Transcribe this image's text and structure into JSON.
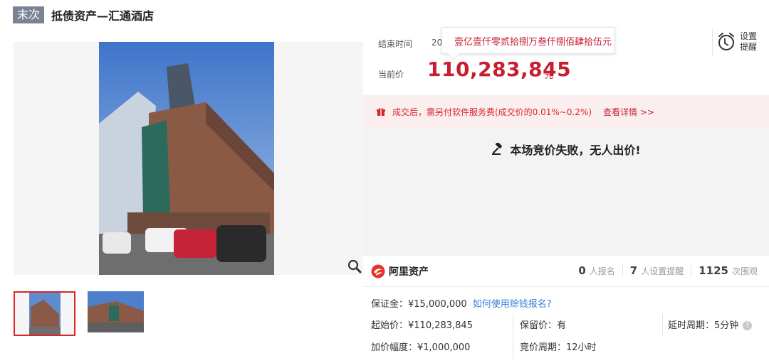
{
  "header": {
    "badge": "末次",
    "title": "抵债资产—汇通酒店"
  },
  "auction": {
    "end_label": "结束时间",
    "end_value": "20",
    "price_label": "当前价",
    "price_value": "110,283,845",
    "price_unit": "元",
    "price_tooltip": "壹亿壹仟零贰拾捌万叁仟捌佰肆拾伍元"
  },
  "remind": {
    "label_line1": "设置",
    "label_line2": "提醒",
    "icon": "alarm-clock-icon"
  },
  "fee_notice": {
    "text": "成交后，需另付软件服务费(成交价的0.01%~0.2%)",
    "link": "查看详情 >>",
    "icon": "gift-icon"
  },
  "result": {
    "text": "本场竞价失败，无人出价!",
    "icon": "gavel-icon"
  },
  "platform": {
    "name": "阿里资产"
  },
  "stats": [
    {
      "num": "0",
      "label": "人报名"
    },
    {
      "num": "7",
      "label": "人设置提醒"
    },
    {
      "num": "1125",
      "label": "次围观"
    }
  ],
  "details": {
    "deposit": "保证金：¥15,000,000",
    "deposit_link": "如何使用赊钱报名?",
    "start_price": "起始价：¥110,283,845",
    "reserve": "保留价：有",
    "delay": "延时周期：5分钟",
    "increment": "加价幅度：¥1,000,000",
    "cycle": "竞价周期：12小时"
  },
  "colors": {
    "accent": "#c81d31",
    "link": "#3a7ed8",
    "badge": "#7a8393"
  }
}
